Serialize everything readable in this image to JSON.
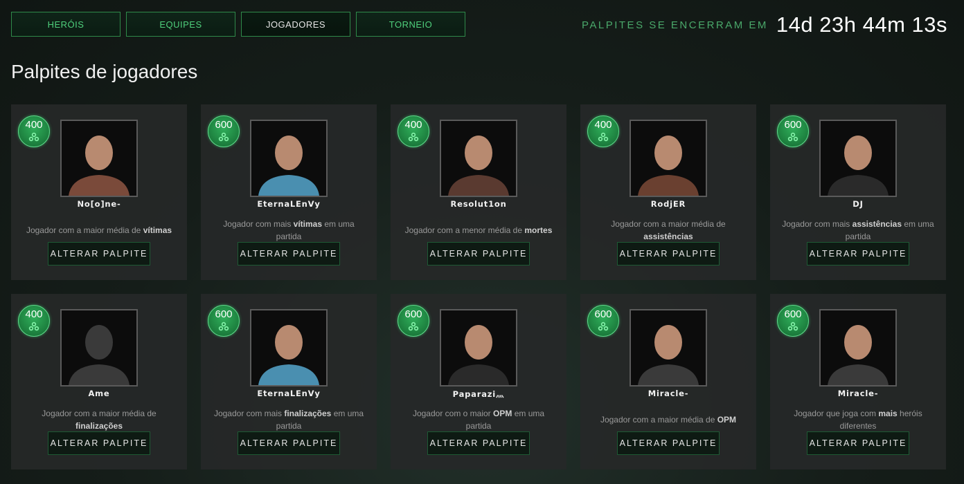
{
  "nav": {
    "tabs": [
      {
        "label": "HERÓIS",
        "active": false
      },
      {
        "label": "EQUIPES",
        "active": false
      },
      {
        "label": "JOGADORES",
        "active": true
      },
      {
        "label": "TORNEIO",
        "active": false
      }
    ]
  },
  "countdown": {
    "label": "PALPITES SE ENCERRAM EM",
    "value": "14d 23h 44m 13s"
  },
  "page_title": "Palpites de jogadores",
  "colors": {
    "accent": "#4fcf7c",
    "badge": "#1c7d3d",
    "card_bg": "#262828"
  },
  "cards": [
    {
      "points": "400",
      "player": "No[o]ne-",
      "desc_pre": "Jogador com a maior média de ",
      "desc_bold": "vítimas",
      "desc_post": "",
      "button": "ALTERAR PALPITE"
    },
    {
      "points": "600",
      "player": "EternaLEnVy",
      "desc_pre": "Jogador com mais ",
      "desc_bold": "vítimas",
      "desc_post": " em uma partida",
      "button": "ALTERAR PALPITE"
    },
    {
      "points": "400",
      "player": "Resolut1on",
      "desc_pre": "Jogador com a menor média de ",
      "desc_bold": "mortes",
      "desc_post": "",
      "button": "ALTERAR PALPITE"
    },
    {
      "points": "400",
      "player": "RodjER",
      "desc_pre": "Jogador com a maior média de ",
      "desc_bold": "assistências",
      "desc_post": "",
      "button": "ALTERAR PALPITE"
    },
    {
      "points": "600",
      "player": "DJ",
      "desc_pre": "Jogador com mais ",
      "desc_bold": "assistências",
      "desc_post": " em uma partida",
      "button": "ALTERAR PALPITE"
    },
    {
      "points": "400",
      "player": "Ame",
      "desc_pre": "Jogador com a maior média de ",
      "desc_bold": "finalizações",
      "desc_post": "",
      "button": "ALTERAR PALPITE"
    },
    {
      "points": "600",
      "player": "EternaLEnVy",
      "desc_pre": "Jogador com mais ",
      "desc_bold": "finalizações",
      "desc_post": " em uma partida",
      "button": "ALTERAR PALPITE"
    },
    {
      "points": "600",
      "player": "Paparazi灬",
      "desc_pre": "Jogador com o maior ",
      "desc_bold": "OPM",
      "desc_post": " em uma partida",
      "button": "ALTERAR PALPITE"
    },
    {
      "points": "600",
      "player": "Miracle-",
      "desc_pre": "Jogador com a maior média de ",
      "desc_bold": "OPM",
      "desc_post": "",
      "button": "ALTERAR PALPITE"
    },
    {
      "points": "600",
      "player": "Miracle-",
      "desc_pre": "Jogador que joga com ",
      "desc_bold": "mais",
      "desc_post": " heróis diferentes",
      "button": "ALTERAR PALPITE"
    }
  ]
}
